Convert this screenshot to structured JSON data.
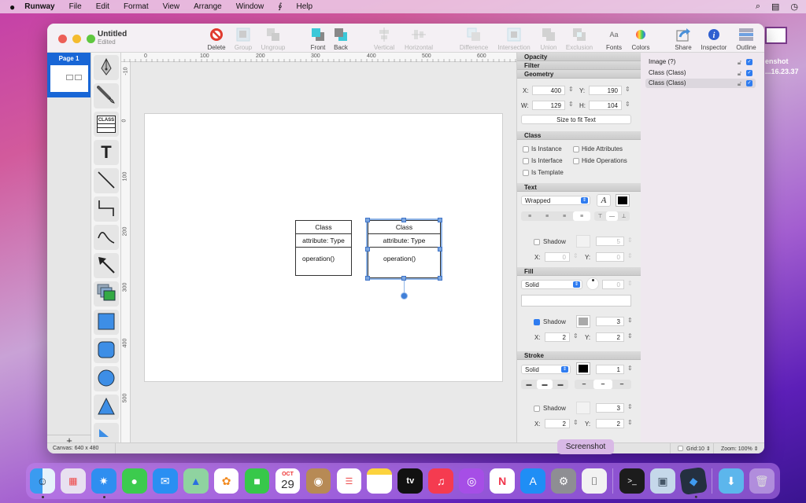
{
  "menubar": {
    "apple": "",
    "items": [
      "Runway",
      "File",
      "Edit",
      "Format",
      "View",
      "Arrange",
      "Window",
      "Script",
      "Help"
    ],
    "script_glyph": "∮"
  },
  "desktop_file": {
    "label_line1": "enshot",
    "label_line2": "...16.23.37"
  },
  "window": {
    "title": "Untitled",
    "subtitle": "Edited",
    "toolbar": [
      {
        "label": "Delete",
        "enabled": true
      },
      {
        "label": "Group",
        "enabled": false
      },
      {
        "label": "Ungroup",
        "enabled": false
      },
      {
        "label": "Front",
        "enabled": true
      },
      {
        "label": "Back",
        "enabled": true
      },
      {
        "label": "Vertical",
        "enabled": false
      },
      {
        "label": "Horizontal",
        "enabled": false
      },
      {
        "label": "Difference",
        "enabled": false
      },
      {
        "label": "Intersection",
        "enabled": false
      },
      {
        "label": "Union",
        "enabled": false
      },
      {
        "label": "Exclusion",
        "enabled": false
      },
      {
        "label": "Fonts",
        "enabled": true
      },
      {
        "label": "Colors",
        "enabled": true
      },
      {
        "label": "Share",
        "enabled": true
      },
      {
        "label": "Inspector",
        "enabled": true
      },
      {
        "label": "Outline",
        "enabled": true
      }
    ],
    "fonts_glyph": "Aa"
  },
  "pages": {
    "items": [
      {
        "label": "Page 1"
      }
    ],
    "add_label": "+"
  },
  "tools": [
    "pen-tool",
    "brush-tool",
    "class-tool",
    "text-tool",
    "line-tool",
    "elbow-connector-tool",
    "curve-tool",
    "arrow-tool",
    "image-tool",
    "rectangle-tool",
    "rounded-rectangle-tool",
    "ellipse-tool",
    "triangle-tool",
    "more-tool"
  ],
  "tools_class_label": "CLASS",
  "tools_text_glyph": "T",
  "ruler": {
    "h_labels": [
      "0",
      "100",
      "200",
      "300",
      "400",
      "500",
      "600"
    ],
    "v_labels": [
      "-10",
      "0",
      "100",
      "200",
      "300",
      "400",
      "500"
    ]
  },
  "canvas": {
    "classes": [
      {
        "name": "Class",
        "attribute": "attribute: Type",
        "operation": "operation()",
        "selected": false
      },
      {
        "name": "Class",
        "attribute": "attribute: Type",
        "operation": "operation()",
        "selected": true
      }
    ]
  },
  "inspector": {
    "sections": {
      "opacity": "Opacity",
      "filter": "Filter",
      "geometry": "Geometry",
      "class": "Class",
      "text": "Text",
      "fill": "Fill",
      "stroke": "Stroke"
    },
    "geometry": {
      "x_label": "X:",
      "x": "400",
      "y_label": "Y:",
      "y": "190",
      "w_label": "W:",
      "w": "129",
      "h_label": "H:",
      "h": "104",
      "fit_button": "Size to fit Text"
    },
    "class": {
      "is_instance": "Is Instance",
      "is_interface": "Is Interface",
      "is_template": "Is Template",
      "hide_attributes": "Hide Attributes",
      "hide_operations": "Hide Operations"
    },
    "text": {
      "wrap_mode": "Wrapped",
      "font_glyph": "A",
      "color": "#000000",
      "shadow_label": "Shadow",
      "shadow_checked": false,
      "shadow_blur": "5",
      "x_label": "X:",
      "x": "0",
      "y_label": "Y:",
      "y": "0"
    },
    "fill": {
      "mode": "Solid",
      "angle": "0",
      "shadow_label": "Shadow",
      "shadow_checked": true,
      "shadow_color": "#aaaaaa",
      "shadow_blur": "3",
      "x_label": "X:",
      "x": "2",
      "y_label": "Y:",
      "y": "2"
    },
    "stroke": {
      "mode": "Solid",
      "color": "#000000",
      "width": "1",
      "shadow_label": "Shadow",
      "shadow_checked": false,
      "shadow_blur": "3",
      "x_label": "X:",
      "x": "2",
      "y_label": "Y:",
      "y": "2"
    }
  },
  "outline": {
    "items": [
      {
        "label": "Image (?)",
        "visible": true,
        "selected": false
      },
      {
        "label": "Class (Class)",
        "visible": true,
        "selected": false
      },
      {
        "label": "Class (Class)",
        "visible": true,
        "selected": true
      }
    ]
  },
  "status": {
    "canvas": "Canvas: 640 x 480",
    "grid": "Grid:10",
    "zoom": "Zoom: 100%"
  },
  "tooltip": "Screenshot",
  "dock": {
    "apps": [
      "Finder",
      "Launchpad",
      "Safari",
      "Messages",
      "Mail",
      "Maps",
      "Photos",
      "FaceTime",
      "Calendar",
      "Contacts",
      "Reminders",
      "Notes",
      "TV",
      "Music",
      "Podcasts",
      "News",
      "App Store",
      "System Preferences",
      "Screenshot",
      "Terminal",
      "Preview",
      "Runway",
      "Downloads",
      "Trash"
    ],
    "calendar_month": "OCT",
    "calendar_day": "29",
    "tv_label": "tv"
  }
}
